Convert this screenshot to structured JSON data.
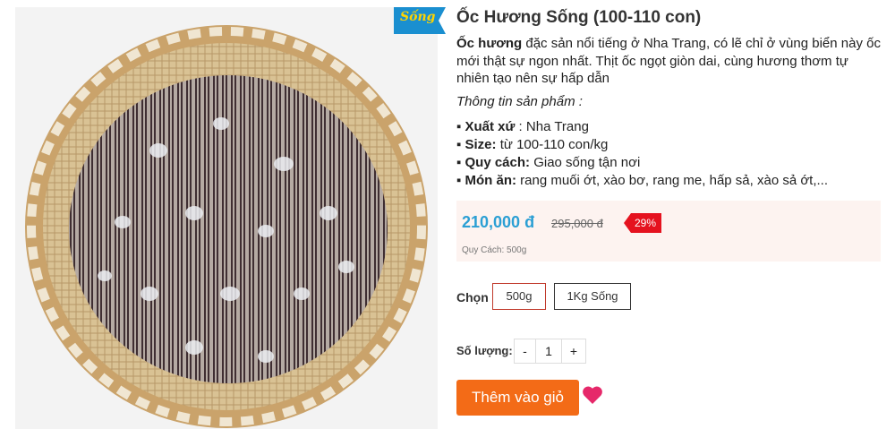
{
  "product": {
    "badge": "Sống",
    "title": "Ốc Hương Sống (100-110 con)",
    "desc_bold": "Ốc hương",
    "desc_rest": " đặc sản nổi tiếng ở Nha Trang, có lẽ chỉ ở vùng biển này ốc mới thật sự ngon nhất. Thịt ốc ngọt giòn dai, cùng hương thơm tự nhiên tạo nên sự hấp dẫn",
    "spec_heading": "Thông tin sản phẩm :",
    "specs": [
      {
        "bullet": "▪ ",
        "label": "Xuất xứ",
        "sep": " : ",
        "value": "Nha Trang"
      },
      {
        "bullet": "▪ ",
        "label": "Size:",
        "sep": " ",
        "value": "từ 100-110 con/kg"
      },
      {
        "bullet": "▪ ",
        "label": "Quy cách:",
        "sep": " ",
        "value": "Giao sống tận nơi"
      },
      {
        "bullet": "▪ ",
        "label": "Món ăn:",
        "sep": " ",
        "value": "rang muối ớt, xào bơ, rang me, hấp sả, xào sả ớt,..."
      }
    ]
  },
  "pricing": {
    "price": "210,000 đ",
    "old_price": "295,000 đ",
    "discount": "29%",
    "unit_note": "Quy Cách: 500g"
  },
  "options": {
    "label": "Chọn",
    "items": [
      "500g",
      "1Kg Sống"
    ],
    "selected": "500g"
  },
  "quantity": {
    "label": "Số lượng:",
    "minus": "-",
    "value": "1",
    "plus": "+"
  },
  "actions": {
    "add_to_cart": "Thêm vào giỏ"
  },
  "colors": {
    "accent_price": "#2b9fd4",
    "cart_button": "#f36b17",
    "discount_badge": "#e5121f",
    "heart": "#e6286a",
    "badge_bg": "#1a8fd0",
    "badge_text": "#ffd400"
  },
  "icons": {
    "favorite": "heart-icon",
    "product_photo": "snail-basket-photo"
  }
}
